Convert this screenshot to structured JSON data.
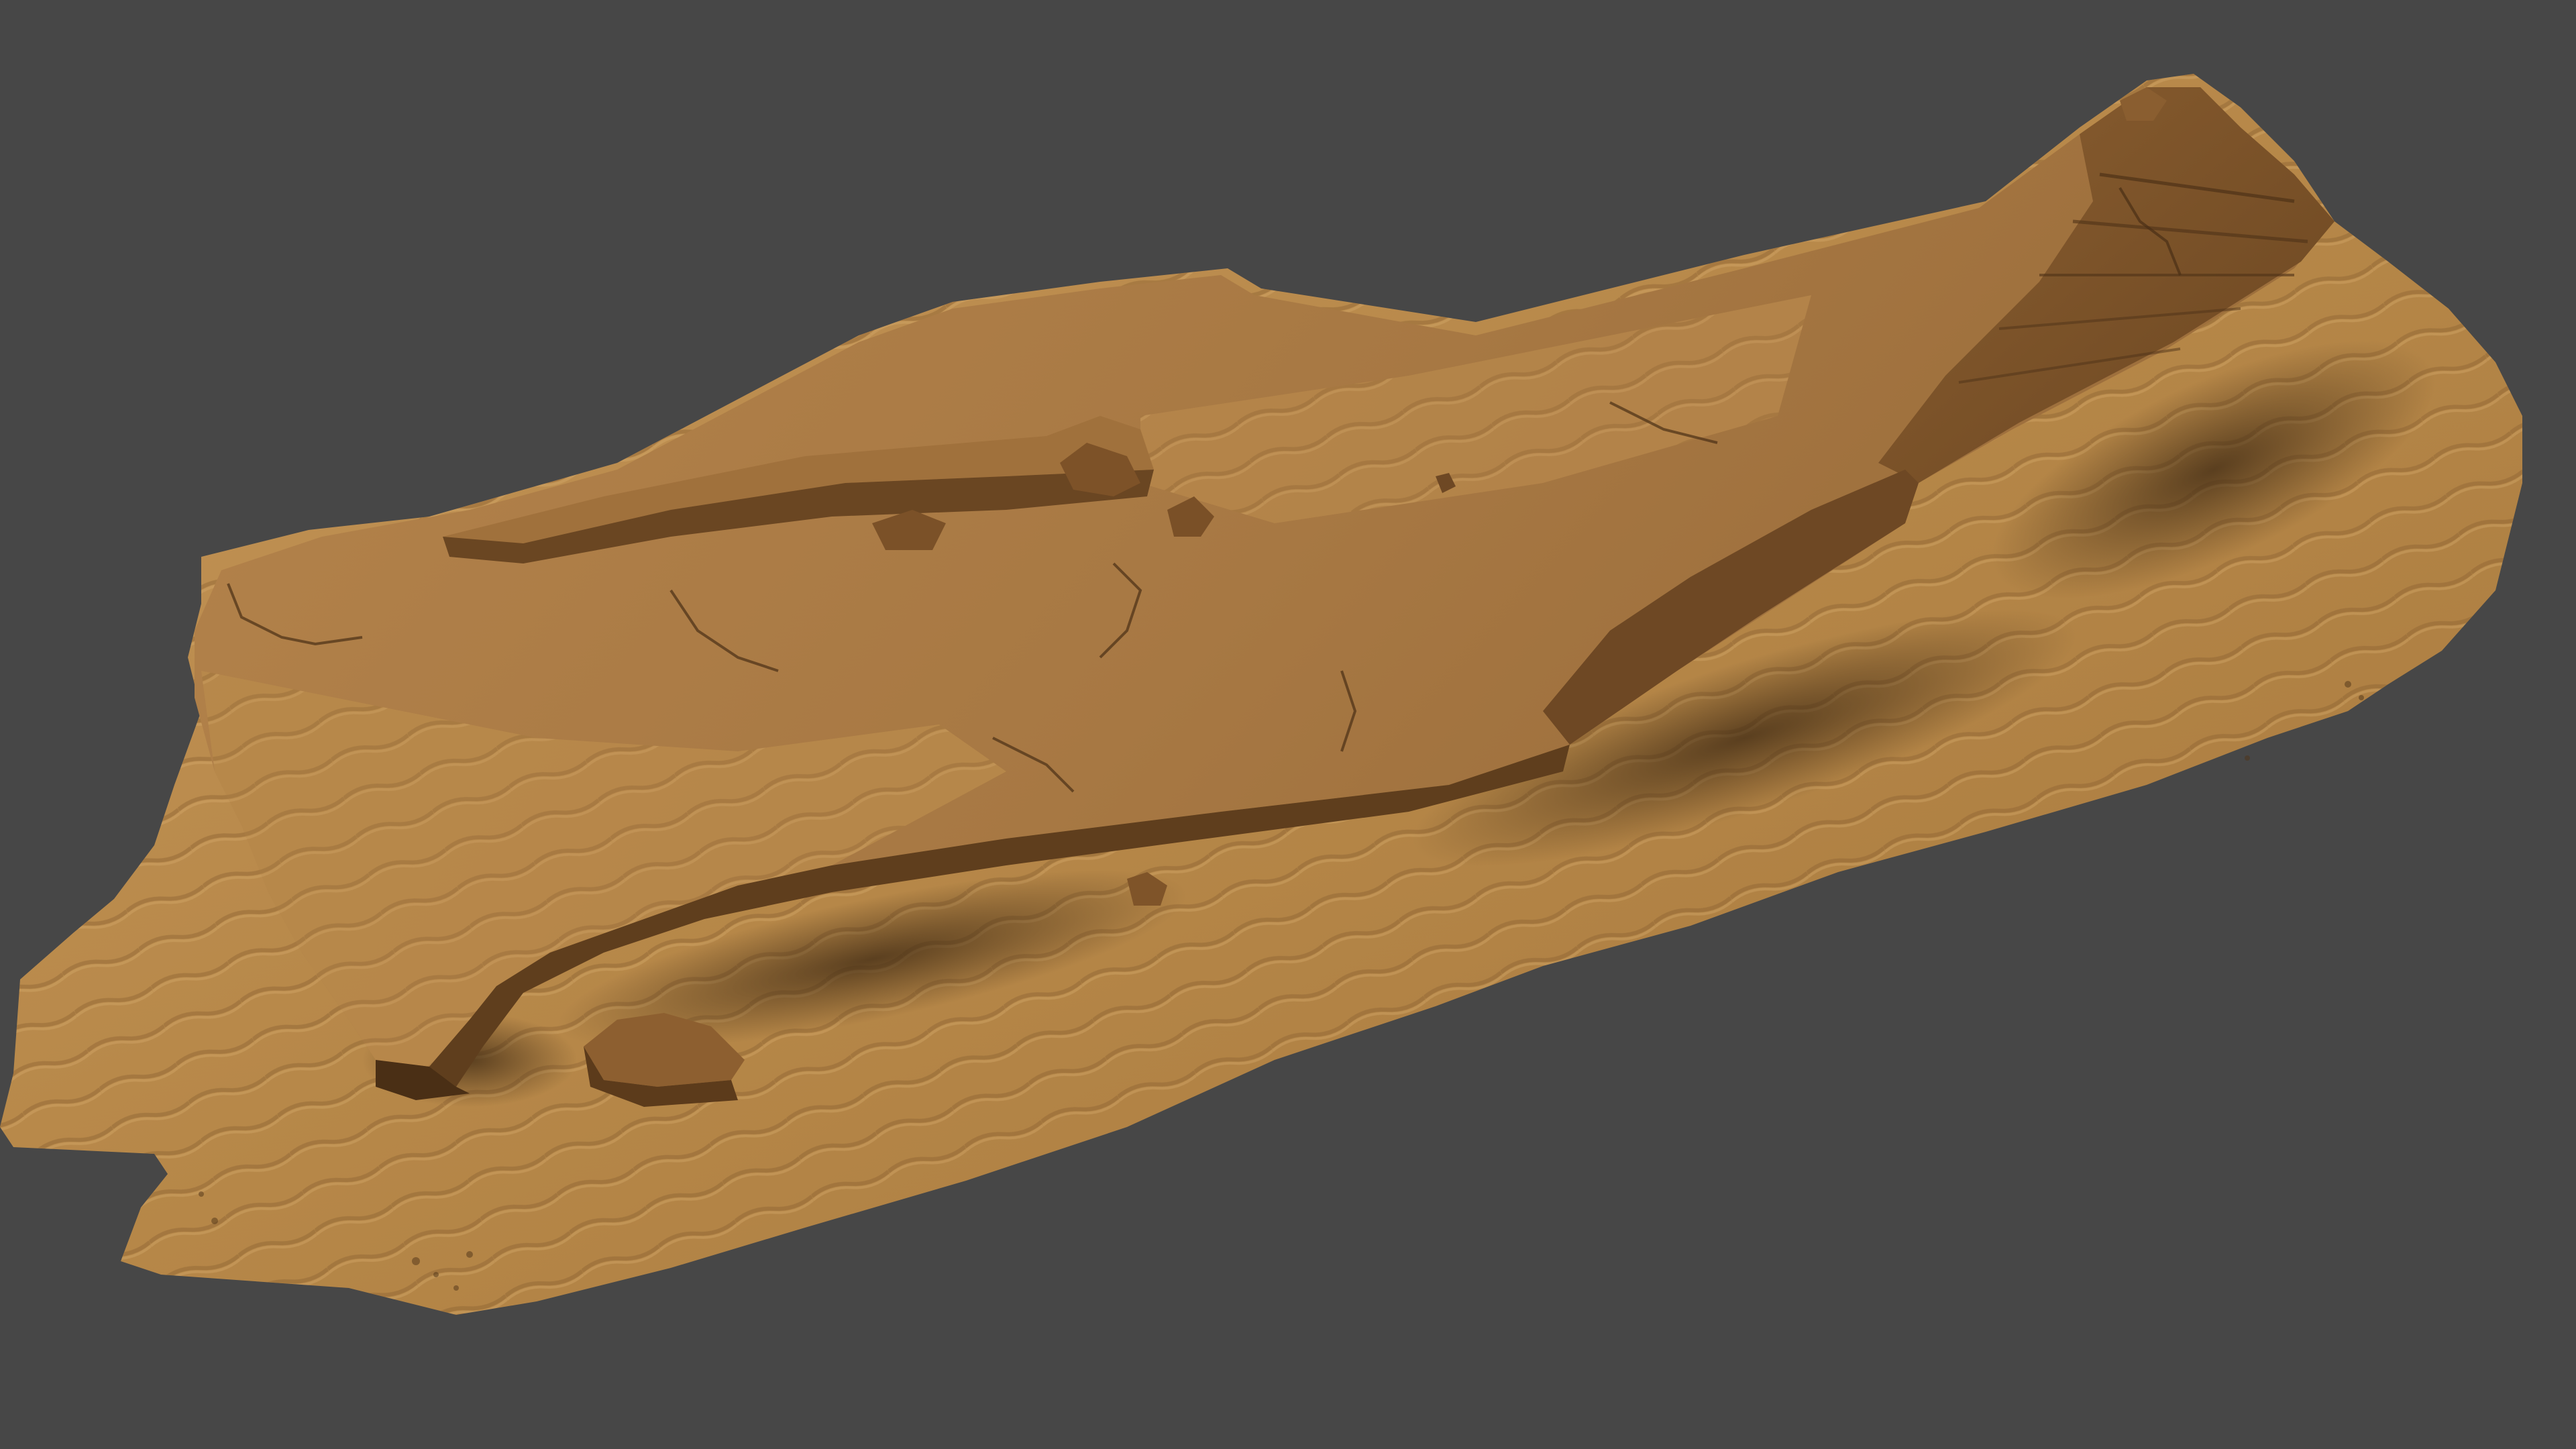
{
  "scene": {
    "background_color": "#474747",
    "subject": "sand-and-rock-terrain-scan",
    "colors": {
      "sand_light": "#c89a5f",
      "sand_mid": "#b07f45",
      "sand_dark": "#8a5f2e",
      "rock_light": "#b88a55",
      "rock_dark": "#5e3f1f",
      "shadow": "#3d2812"
    }
  }
}
